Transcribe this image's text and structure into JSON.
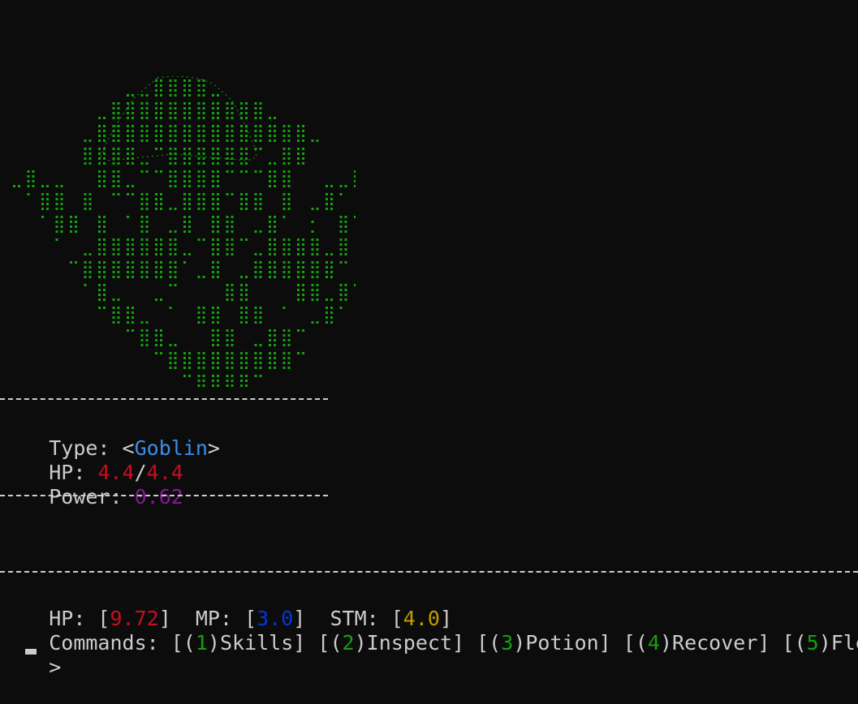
{
  "monster": {
    "art_icon": "goblin-face-ascii-art",
    "type_label": "Type: ",
    "type_open": "<",
    "type_value": "Goblin",
    "type_close": ">",
    "hp_label": "HP: ",
    "hp_current": "4.4",
    "hp_slash": "/",
    "hp_max": "4.4",
    "power_label": "Power: ",
    "power_value": "0.62"
  },
  "status": {
    "hp_label": "HP: [",
    "hp_value": "9.72",
    "hp_close": "]",
    "mp_label": "MP: [",
    "mp_value": "3.0",
    "mp_close": "]",
    "stm_label": "STM: [",
    "stm_value": "4.0",
    "stm_close": "]"
  },
  "commands": {
    "label": "Commands: ",
    "items": [
      {
        "open": "[(",
        "num": "1",
        "mid": ")",
        "label": "Skills",
        "close": "]"
      },
      {
        "open": "[(",
        "num": "2",
        "mid": ")",
        "label": "Inspect",
        "close": "]"
      },
      {
        "open": "[(",
        "num": "3",
        "mid": ")",
        "label": "Potion",
        "close": "]"
      },
      {
        "open": "[(",
        "num": "4",
        "mid": ")",
        "label": "Recover",
        "close": "]"
      },
      {
        "open": "[(",
        "num": "5",
        "mid": ")",
        "label": "Flee",
        "close": "]"
      }
    ]
  },
  "prompt": {
    "symbol": ">"
  },
  "colors": {
    "background": "#0c0c0c",
    "text": "#cccccc",
    "art": "#13a10e",
    "type": "#3b8eea",
    "monster_hp": "#c50f1f",
    "power": "#881798",
    "mp": "#0037da",
    "stm": "#c19c00",
    "command_number": "#13a10e"
  }
}
